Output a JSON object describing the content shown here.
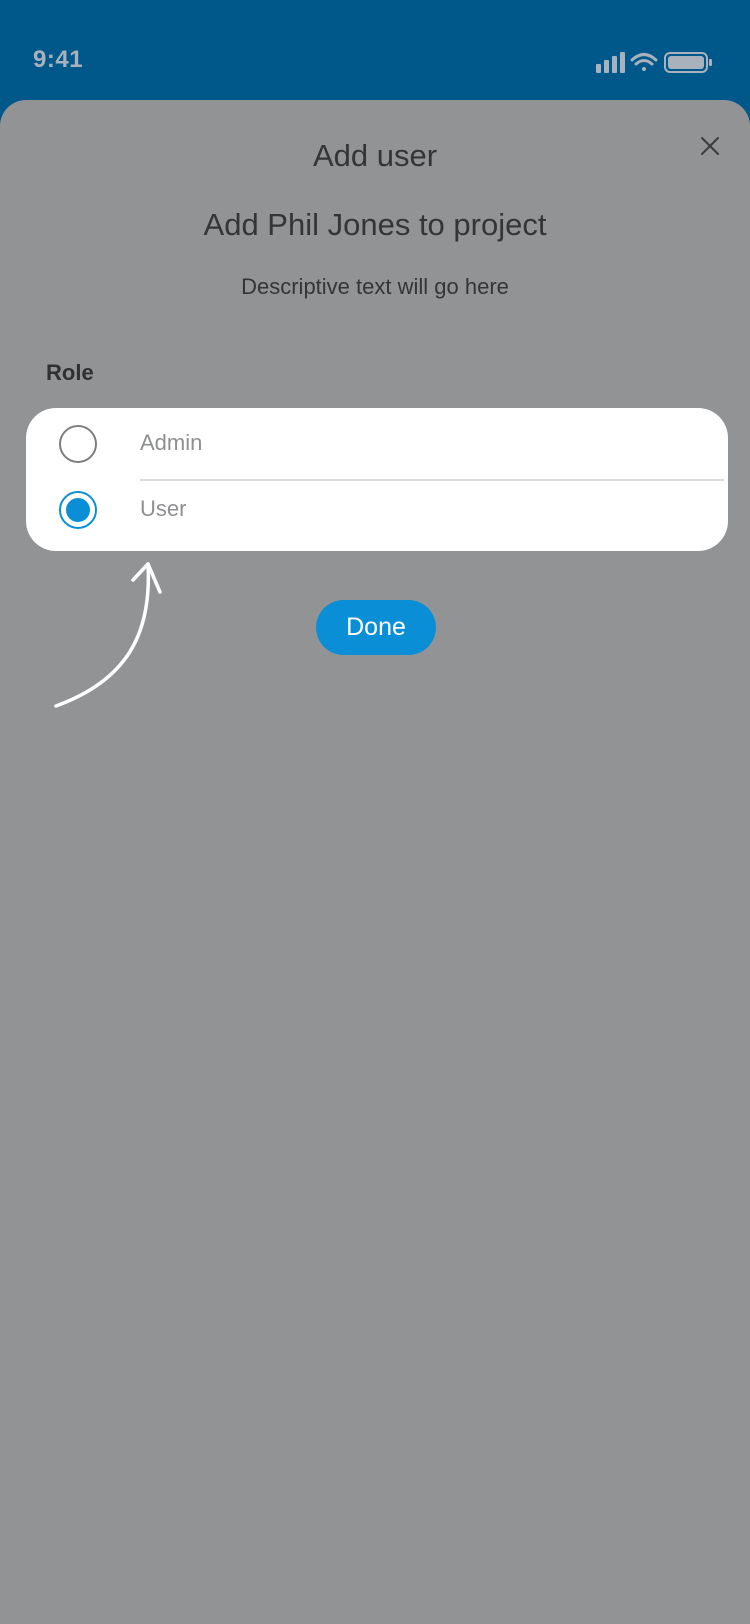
{
  "status_bar": {
    "time": "9:41",
    "icons": [
      "signal-icon",
      "wifi-icon",
      "battery-icon"
    ]
  },
  "sheet": {
    "title": "Add user",
    "close_icon": "close-icon"
  },
  "content": {
    "heading": "Add Phil Jones to project",
    "description": "Descriptive text will go here",
    "role_label": "Role",
    "options": [
      {
        "label": "Admin",
        "selected": false
      },
      {
        "label": "User",
        "selected": true
      }
    ],
    "done_label": "Done"
  },
  "annotation": {
    "icon": "curved-arrow-icon"
  },
  "colors": {
    "header_bg": "#005789",
    "overlay_bg": "#929395",
    "accent": "#0a8fd6"
  }
}
